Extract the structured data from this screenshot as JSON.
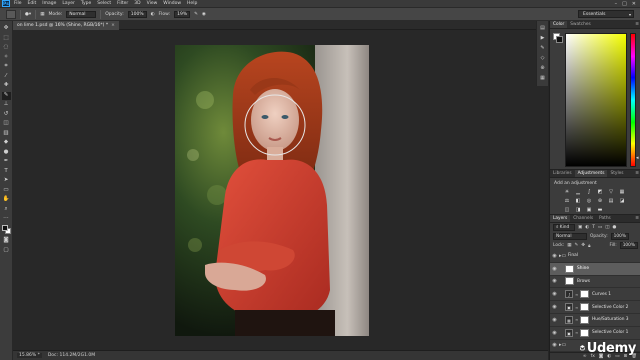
{
  "app": {
    "logo": "Ps"
  },
  "menu": [
    "File",
    "Edit",
    "Image",
    "Layer",
    "Type",
    "Select",
    "Filter",
    "3D",
    "View",
    "Window",
    "Help"
  ],
  "window_controls": [
    "–",
    "□",
    "✕"
  ],
  "options_bar": {
    "mode_label": "Mode:",
    "mode_value": "Normal",
    "opacity_label": "Opacity:",
    "opacity_value": "100%",
    "flow_label": "Flow:",
    "flow_value": "19%",
    "workspace": "Essentials"
  },
  "document": {
    "tab_title": "on lime 1.psd @ 16% (Shine, RGB/16*) *",
    "zoom": "15.86% *",
    "doc_info": "Doc: 114.2M/2G1.0M"
  },
  "color_panel": {
    "tabs": [
      "Color",
      "Swatches"
    ],
    "active_tab": "Color",
    "hue_top": "#ff0000",
    "field_color": "#f5ff00"
  },
  "adjustments_panel": {
    "tabs": [
      "Libraries",
      "Adjustments",
      "Styles"
    ],
    "active_tab": "Adjustments",
    "title": "Add an adjustment",
    "icons": [
      "sun",
      "levels",
      "curves",
      "exposure",
      "vibrance",
      "hue-sat",
      "color-balance",
      "bw",
      "photo-filter",
      "channel-mixer",
      "color-lookup",
      "invert",
      "posterize",
      "threshold",
      "selective-color",
      "gradient-map"
    ]
  },
  "layers_panel": {
    "tabs": [
      "Layers",
      "Channels",
      "Paths"
    ],
    "active_tab": "Layers",
    "filter_label": "Kind",
    "blend_mode": "Normal",
    "opacity_label": "Opacity:",
    "opacity_value": "100%",
    "lock_label": "Lock:",
    "fill_label": "Fill:",
    "fill_value": "100%",
    "layers": [
      {
        "name": "Final",
        "type": "group",
        "selected": false
      },
      {
        "name": "Shine",
        "type": "layer",
        "selected": true
      },
      {
        "name": "Brows",
        "type": "layer",
        "selected": false
      },
      {
        "name": "Curves 1",
        "type": "adjustment",
        "selected": false
      },
      {
        "name": "Selective Color 2",
        "type": "adjustment",
        "selected": false
      },
      {
        "name": "Hue/Saturation 3",
        "type": "adjustment",
        "selected": false
      },
      {
        "name": "Selective Color 1",
        "type": "adjustment",
        "selected": false
      },
      {
        "name": "",
        "type": "group",
        "selected": false
      }
    ]
  },
  "watermark": {
    "text": "Udemy"
  }
}
